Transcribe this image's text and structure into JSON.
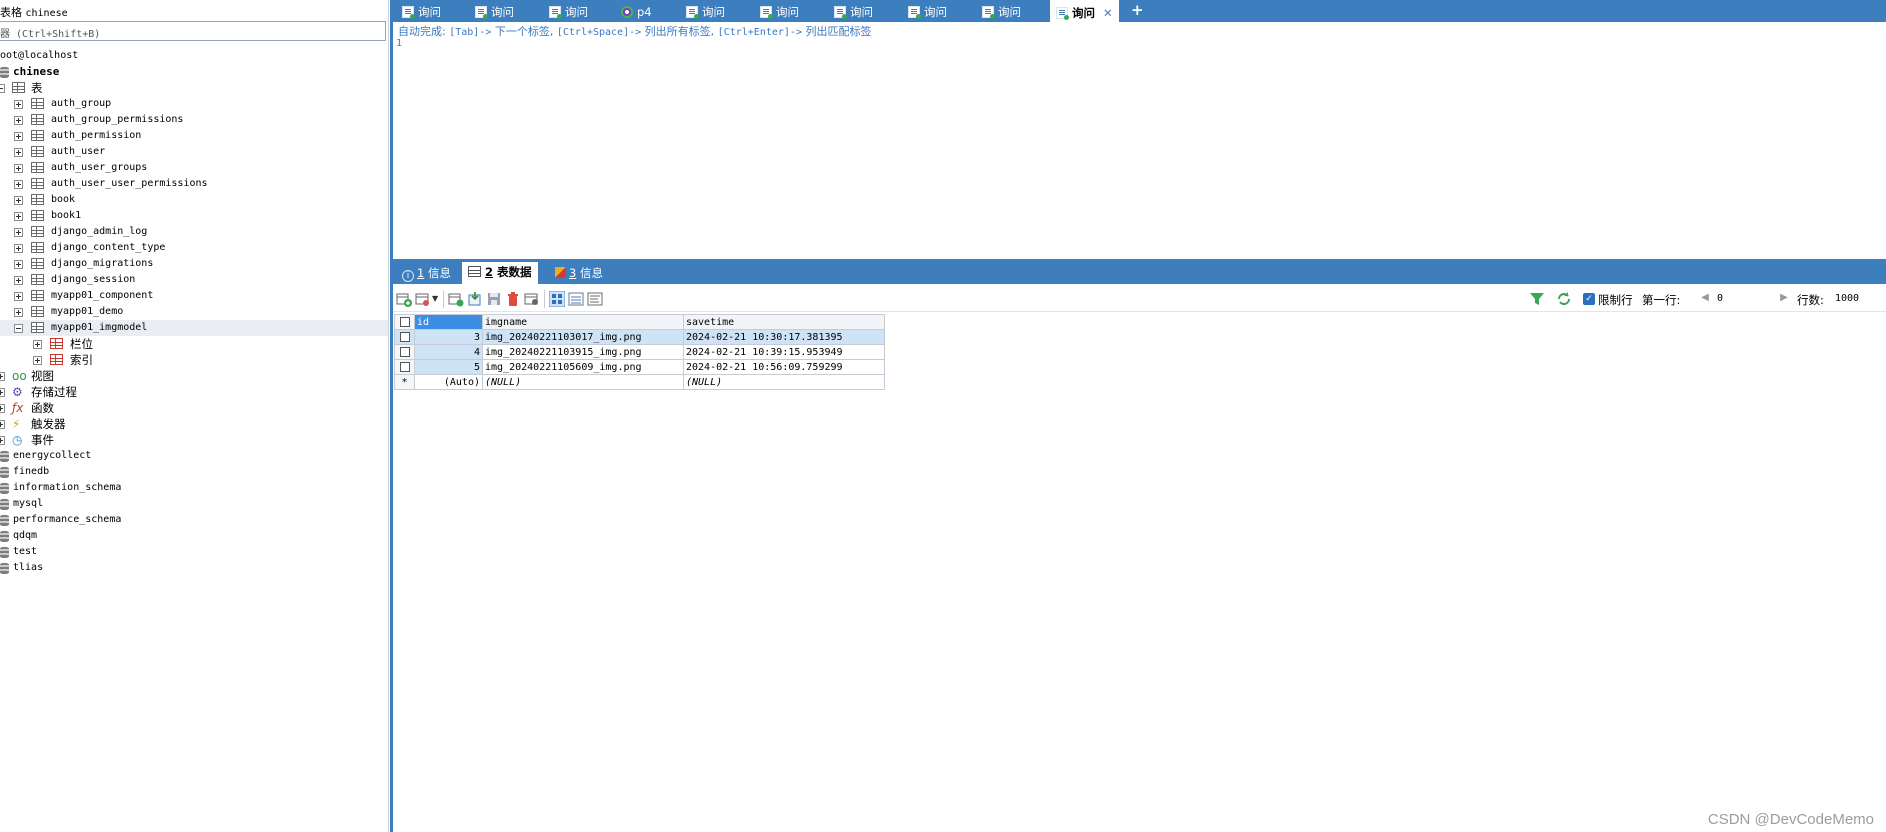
{
  "left": {
    "filter_label": "表格",
    "filter_db": "chinese",
    "filter_placeholder": "器 (Ctrl+Shift+B)",
    "tree": [
      {
        "label": "oot@localhost",
        "kind": "conn"
      },
      {
        "label": "chinese",
        "kind": "db",
        "bold": true
      },
      {
        "label": "表",
        "kind": "folder-tables"
      },
      {
        "label": "auth_group",
        "kind": "table"
      },
      {
        "label": "auth_group_permissions",
        "kind": "table"
      },
      {
        "label": "auth_permission",
        "kind": "table"
      },
      {
        "label": "auth_user",
        "kind": "table"
      },
      {
        "label": "auth_user_groups",
        "kind": "table"
      },
      {
        "label": "auth_user_user_permissions",
        "kind": "table"
      },
      {
        "label": "book",
        "kind": "table"
      },
      {
        "label": "book1",
        "kind": "table"
      },
      {
        "label": "django_admin_log",
        "kind": "table"
      },
      {
        "label": "django_content_type",
        "kind": "table"
      },
      {
        "label": "django_migrations",
        "kind": "table"
      },
      {
        "label": "django_session",
        "kind": "table"
      },
      {
        "label": "myapp01_component",
        "kind": "table"
      },
      {
        "label": "myapp01_demo",
        "kind": "table"
      },
      {
        "label": "myapp01_imgmodel",
        "kind": "table-open"
      },
      {
        "label": "栏位",
        "kind": "columns"
      },
      {
        "label": "索引",
        "kind": "indexes"
      },
      {
        "label": "视图",
        "kind": "views"
      },
      {
        "label": "存储过程",
        "kind": "procs"
      },
      {
        "label": "函数",
        "kind": "funcs"
      },
      {
        "label": "触发器",
        "kind": "triggers"
      },
      {
        "label": "事件",
        "kind": "events"
      },
      {
        "label": "energycollect",
        "kind": "db2"
      },
      {
        "label": "finedb",
        "kind": "db2"
      },
      {
        "label": "information_schema",
        "kind": "db2"
      },
      {
        "label": "mysql",
        "kind": "db2"
      },
      {
        "label": "performance_schema",
        "kind": "db2"
      },
      {
        "label": "qdqm",
        "kind": "db2"
      },
      {
        "label": "test",
        "kind": "db2"
      },
      {
        "label": "tlias",
        "kind": "db2"
      }
    ]
  },
  "query_tabs": [
    {
      "label": "询问",
      "icon": "query-icon"
    },
    {
      "label": "询问",
      "icon": "query-icon"
    },
    {
      "label": "询问",
      "icon": "query-icon"
    },
    {
      "label": "p4",
      "icon": "profile-icon"
    },
    {
      "label": "询问",
      "icon": "query-icon"
    },
    {
      "label": "询问",
      "icon": "query-icon"
    },
    {
      "label": "询问",
      "icon": "query-icon"
    },
    {
      "label": "询问",
      "icon": "query-icon"
    },
    {
      "label": "询问",
      "icon": "query-icon"
    },
    {
      "label": "询问",
      "icon": "query-icon",
      "active": true
    }
  ],
  "editor": {
    "hint_prefix": "自动完成:",
    "hint_k1": "[Tab]->",
    "hint_t1": "下一个标签,",
    "hint_k2": "[Ctrl+Space]->",
    "hint_t2": "列出所有标签,",
    "hint_k3": "[Ctrl+Enter]->",
    "hint_t3": "列出匹配标签",
    "line_number": "1"
  },
  "result_tabs": [
    {
      "num": "1",
      "label": "信息"
    },
    {
      "num": "2",
      "label": "表数据",
      "active": true
    },
    {
      "num": "3",
      "label": "信息"
    }
  ],
  "toolbar": {
    "limit_label": "限制行",
    "first_row_label": "第一行:",
    "first_row_value": "0",
    "rows_label": "行数:",
    "rows_value": "1000"
  },
  "grid": {
    "columns": [
      "id",
      "imgname",
      "savetime"
    ],
    "rows": [
      {
        "id": "3",
        "imgname": "img_20240221103017_img.png",
        "savetime": "2024-02-21 10:30:17.381395"
      },
      {
        "id": "4",
        "imgname": "img_20240221103915_img.png",
        "savetime": "2024-02-21 10:39:15.953949"
      },
      {
        "id": "5",
        "imgname": "img_20240221105609_img.png",
        "savetime": "2024-02-21 10:56:09.759299"
      }
    ],
    "new_row": {
      "marker": "*",
      "id": "(Auto)",
      "imgname": "(NULL)",
      "savetime": "(NULL)"
    }
  },
  "watermark": "CSDN @DevCodeMemo"
}
